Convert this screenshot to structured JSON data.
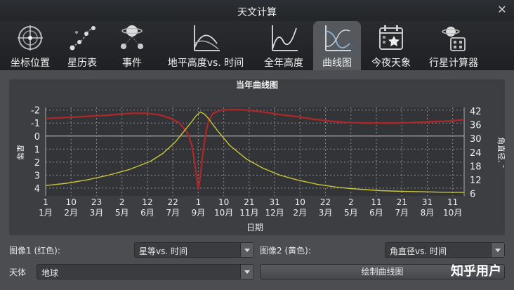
{
  "window": {
    "title": "天文计算",
    "close_icon": "close-icon"
  },
  "tabs": [
    {
      "label": "坐标位置",
      "icon": "compass-icon"
    },
    {
      "label": "星历表",
      "icon": "ephemeris-icon"
    },
    {
      "label": "事件",
      "icon": "planet-events-icon"
    },
    {
      "label": "地平高度vs. 时间",
      "icon": "altitude-chart-icon"
    },
    {
      "label": "全年高度",
      "icon": "yearly-altitude-icon"
    },
    {
      "label": "曲线图",
      "icon": "graph-icon",
      "active": true
    },
    {
      "label": "今夜天象",
      "icon": "calendar-star-icon"
    },
    {
      "label": "行星计算器",
      "icon": "planet-calculator-icon"
    }
  ],
  "chart_data": {
    "type": "line",
    "title": "当年曲线图",
    "xlabel": "日期",
    "ylabel_left": "星等",
    "ylabel_right": "角直径, ″",
    "x_ticks": [
      {
        "day": "1",
        "month": "1月"
      },
      {
        "day": "10",
        "month": "2月"
      },
      {
        "day": "23",
        "month": "3月"
      },
      {
        "day": "2",
        "month": "5月"
      },
      {
        "day": "12",
        "month": "6月"
      },
      {
        "day": "22",
        "month": "7月"
      },
      {
        "day": "1",
        "month": "9月"
      },
      {
        "day": "10",
        "month": "10月"
      },
      {
        "day": "21",
        "month": "11月"
      },
      {
        "day": "31",
        "month": "12月"
      },
      {
        "day": "10",
        "month": "2月"
      },
      {
        "day": "22",
        "month": "3月"
      },
      {
        "day": "2",
        "month": "5月"
      },
      {
        "day": "11",
        "month": "6月"
      },
      {
        "day": "21",
        "month": "7月"
      },
      {
        "day": "31",
        "month": "8月"
      },
      {
        "day": "11",
        "month": "10月"
      }
    ],
    "left_ticks": [
      "-2",
      "-1",
      "0",
      "1",
      "2",
      "3",
      "4"
    ],
    "left_ylim": [
      -2.2,
      4.6
    ],
    "right_ticks": [
      "42",
      "36",
      "30",
      "24",
      "18",
      "12",
      "6"
    ],
    "right_ylim": [
      5,
      43.5
    ],
    "grid": true,
    "series": [
      {
        "color": "#a8282c",
        "x": [
          0,
          0.03,
          0.06,
          0.09,
          0.12,
          0.15,
          0.18,
          0.21,
          0.24,
          0.27,
          0.3,
          0.32,
          0.34,
          0.35,
          0.355,
          0.36,
          0.365,
          0.37,
          0.375,
          0.38,
          0.385,
          0.39,
          0.4,
          0.42,
          0.45,
          0.48,
          0.52,
          0.56,
          0.6,
          0.64,
          0.68,
          0.72,
          0.76,
          0.8,
          0.84,
          0.88,
          0.92,
          0.96,
          1.0
        ],
        "y": [
          -1.35,
          -1.4,
          -1.45,
          -1.5,
          -1.55,
          -1.6,
          -1.7,
          -1.75,
          -1.75,
          -1.65,
          -1.35,
          -1.0,
          -0.2,
          0.8,
          1.8,
          3.0,
          4.1,
          3.0,
          1.5,
          0.3,
          -0.6,
          -1.2,
          -1.75,
          -2.0,
          -2.05,
          -2.0,
          -1.85,
          -1.65,
          -1.5,
          -1.3,
          -1.15,
          -1.05,
          -1.0,
          -1.0,
          -1.0,
          -1.05,
          -1.1,
          -1.15,
          -1.25
        ]
      },
      {
        "color": "#c9c635",
        "x": [
          0,
          0.05,
          0.1,
          0.15,
          0.2,
          0.25,
          0.28,
          0.31,
          0.33,
          0.35,
          0.36,
          0.37,
          0.38,
          0.39,
          0.41,
          0.44,
          0.48,
          0.52,
          0.56,
          0.6,
          0.65,
          0.7,
          0.75,
          0.8,
          0.85,
          0.9,
          0.95,
          1.0
        ],
        "y": [
          9.5,
          10.5,
          12,
          14,
          16.5,
          20,
          23.5,
          28.5,
          33,
          37.5,
          40,
          41.5,
          40.5,
          38.5,
          33.5,
          27,
          21,
          17,
          14,
          12,
          10,
          8.7,
          7.9,
          7.3,
          7.0,
          6.8,
          6.6,
          6.5
        ]
      }
    ]
  },
  "controls": {
    "graph1_label": "图像1 (红色):",
    "graph1_value": "星等vs. 时间",
    "graph2_label": "图像2 (黄色):",
    "graph2_value": "角直径vs. 时间",
    "object_label": "天体",
    "object_value": "地球",
    "draw_button": "绘制曲线图"
  },
  "watermark": "知乎用户"
}
